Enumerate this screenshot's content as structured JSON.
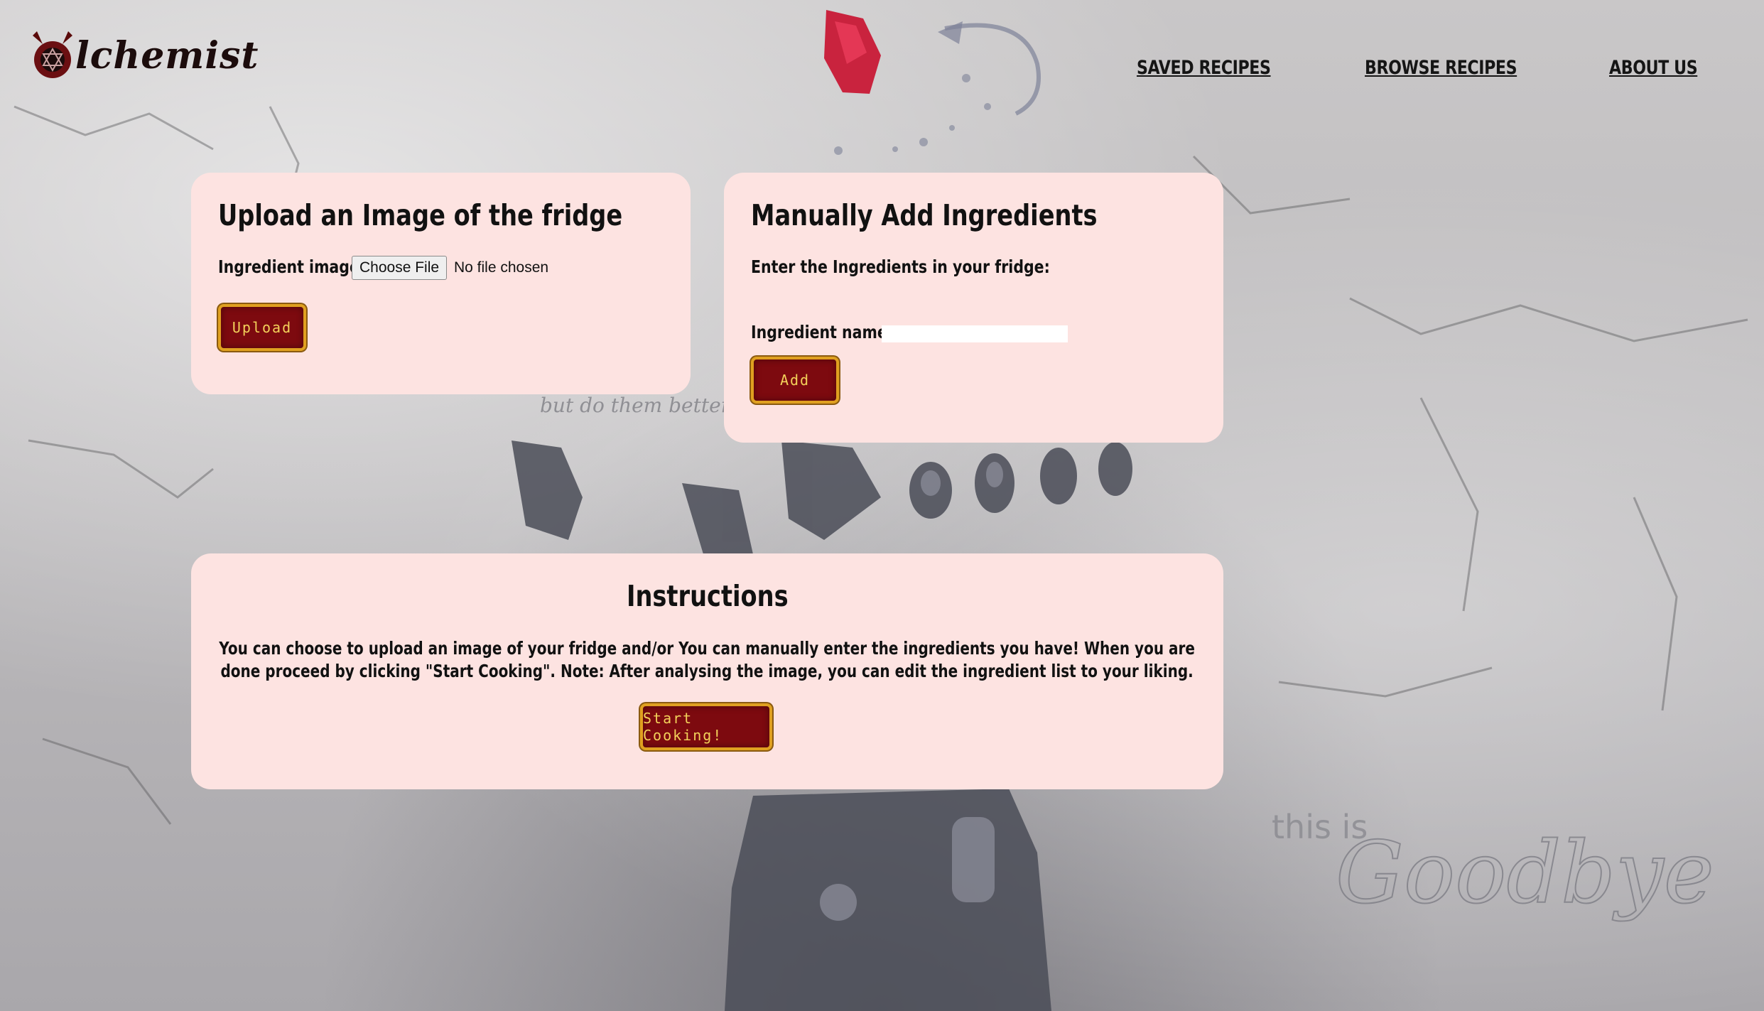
{
  "header": {
    "logo_text": "lchemist",
    "nav": [
      {
        "label": "SAVED RECIPES"
      },
      {
        "label": "BROWSE RECIPES"
      },
      {
        "label": "ABOUT US"
      }
    ]
  },
  "upload_card": {
    "title": "Upload an Image of the fridge",
    "field_label": "Ingredient image:",
    "file_button": "Choose File",
    "file_status": "No file chosen",
    "submit_label": "Upload"
  },
  "manual_card": {
    "title": "Manually Add Ingredients",
    "prompt": "Enter the Ingredients in your fridge:",
    "field_label": "Ingredient name:",
    "input_value": "",
    "submit_label": "Add"
  },
  "instructions_card": {
    "title": "Instructions",
    "text": "You can choose to upload an image of your fridge and/or You can manually enter the ingredients you have! When you are done proceed by clicking \"Start Cooking\". Note: After analysing the image, you can edit the ingredient list to your liking.",
    "submit_label": "Start Cooking!"
  },
  "background_text": {
    "line1": "but do them better",
    "line2": "this is",
    "line3": "Goodbye"
  },
  "colors": {
    "card_bg": "#fde3e1",
    "button_bg": "#7d0a0f",
    "button_border": "#e0a020",
    "button_text": "#f3d15a"
  }
}
